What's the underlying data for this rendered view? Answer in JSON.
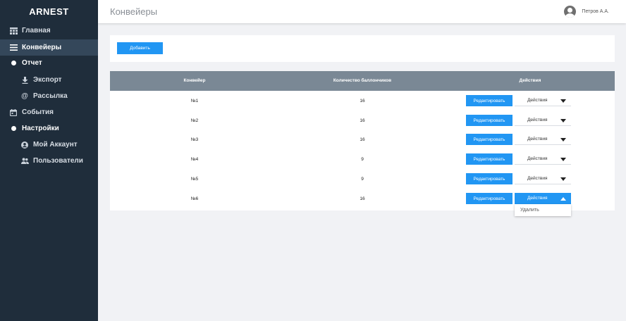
{
  "sidebar": {
    "brand": "ARNEST",
    "items": [
      {
        "label": "Главная",
        "icon": "table-icon"
      },
      {
        "label": "Конвейеры",
        "icon": "menu-icon"
      },
      {
        "label": "Отчет",
        "icon": "dot-icon"
      },
      {
        "label": "Экспорт",
        "icon": "download-icon"
      },
      {
        "label": "Рассылка",
        "icon": "at-icon"
      },
      {
        "label": "События",
        "icon": "calendar-icon"
      },
      {
        "label": "Настройки",
        "icon": "dot-icon"
      },
      {
        "label": "Мой Аккаунт",
        "icon": "account-icon"
      },
      {
        "label": "Пользователи",
        "icon": "users-icon"
      }
    ]
  },
  "header": {
    "title": "Конвейеры",
    "user_name": "Петров А.А."
  },
  "toolbar": {
    "add_label": "Добавить"
  },
  "table": {
    "columns": [
      "Конвейер",
      "Количество баллончиков",
      "Действия"
    ],
    "rows": [
      {
        "name": "№1",
        "count": "16"
      },
      {
        "name": "№2",
        "count": "16"
      },
      {
        "name": "№3",
        "count": "16"
      },
      {
        "name": "№4",
        "count": "9"
      },
      {
        "name": "№5",
        "count": "9"
      },
      {
        "name": "№6",
        "count": "16"
      }
    ],
    "edit_label": "Редактировать",
    "actions_label": "Действия"
  },
  "dropdown_menu": {
    "items": [
      "Удалить"
    ]
  },
  "colors": {
    "sidebar_bg": "#1f2d3b",
    "accent": "#2196f3",
    "table_header": "#7a8895"
  }
}
